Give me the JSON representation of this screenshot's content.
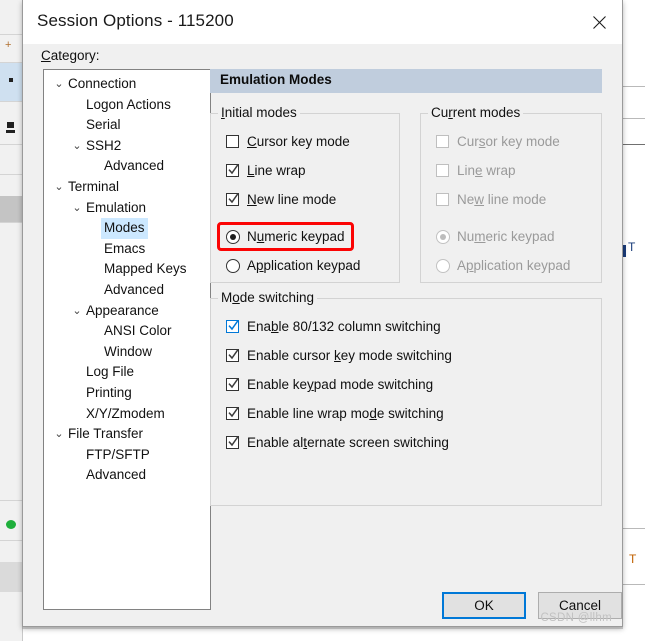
{
  "window": {
    "title": "Session Options - 115200",
    "close_icon": "close-icon"
  },
  "category": {
    "label_prefix": "C",
    "label_rest": "ategory:",
    "tree": [
      {
        "label": "Connection",
        "indent": 0,
        "chevron": "⌄",
        "selected": false
      },
      {
        "label": "Logon Actions",
        "indent": 1,
        "chevron": "",
        "selected": false
      },
      {
        "label": "Serial",
        "indent": 1,
        "chevron": "",
        "selected": false
      },
      {
        "label": "SSH2",
        "indent": 1,
        "chevron": "⌄",
        "selected": false
      },
      {
        "label": "Advanced",
        "indent": 2,
        "chevron": "",
        "selected": false
      },
      {
        "label": "Terminal",
        "indent": 0,
        "chevron": "⌄",
        "selected": false
      },
      {
        "label": "Emulation",
        "indent": 1,
        "chevron": "⌄",
        "selected": false
      },
      {
        "label": "Modes",
        "indent": 2,
        "chevron": "",
        "selected": true
      },
      {
        "label": "Emacs",
        "indent": 2,
        "chevron": "",
        "selected": false
      },
      {
        "label": "Mapped Keys",
        "indent": 2,
        "chevron": "",
        "selected": false
      },
      {
        "label": "Advanced",
        "indent": 2,
        "chevron": "",
        "selected": false
      },
      {
        "label": "Appearance",
        "indent": 1,
        "chevron": "⌄",
        "selected": false
      },
      {
        "label": "ANSI Color",
        "indent": 2,
        "chevron": "",
        "selected": false
      },
      {
        "label": "Window",
        "indent": 2,
        "chevron": "",
        "selected": false
      },
      {
        "label": "Log File",
        "indent": 1,
        "chevron": "",
        "selected": false
      },
      {
        "label": "Printing",
        "indent": 1,
        "chevron": "",
        "selected": false
      },
      {
        "label": "X/Y/Zmodem",
        "indent": 1,
        "chevron": "",
        "selected": false
      },
      {
        "label": "File Transfer",
        "indent": 0,
        "chevron": "⌄",
        "selected": false
      },
      {
        "label": "FTP/SFTP",
        "indent": 1,
        "chevron": "",
        "selected": false
      },
      {
        "label": "Advanced",
        "indent": 1,
        "chevron": "",
        "selected": false
      }
    ]
  },
  "pane": {
    "header": "Emulation Modes"
  },
  "initial_modes": {
    "title_pre": "I",
    "title_post": "nitial modes",
    "checkboxes": [
      {
        "pre": "",
        "acc": "C",
        "post": "ursor key mode",
        "checked": false
      },
      {
        "pre": "",
        "acc": "L",
        "post": "ine wrap",
        "checked": true
      },
      {
        "pre": "",
        "acc": "N",
        "post": "ew line mode",
        "checked": true
      }
    ],
    "radios": [
      {
        "pre": "N",
        "acc": "u",
        "post": "meric keypad",
        "selected": true
      },
      {
        "pre": "A",
        "acc": "p",
        "post": "plication keypad",
        "selected": false
      }
    ]
  },
  "current_modes": {
    "title_pre": "Cu",
    "title_acc": "r",
    "title_post": "rent modes",
    "disabled": true,
    "checkboxes": [
      {
        "pre": "Cur",
        "acc": "s",
        "post": "or key mode",
        "checked": false
      },
      {
        "pre": "Lin",
        "acc": "e",
        "post": " wrap",
        "checked": false
      },
      {
        "pre": "Ne",
        "acc": "w",
        "post": " line mode",
        "checked": false
      }
    ],
    "radios": [
      {
        "pre": "Nu",
        "acc": "m",
        "post": "eric keypad",
        "selected": true
      },
      {
        "pre": "A",
        "acc": "p",
        "post": "plication keypad",
        "selected": false
      }
    ]
  },
  "mode_switching": {
    "title_pre": "M",
    "title_acc": "o",
    "title_post": "de switching",
    "checkboxes": [
      {
        "pre": "Ena",
        "acc": "b",
        "post": "le 80/132 column switching",
        "checked": true,
        "focused": true
      },
      {
        "pre": "Enable cursor ",
        "acc": "k",
        "post": "ey mode switching",
        "checked": true,
        "focused": false
      },
      {
        "pre": "Enable ke",
        "acc": "y",
        "post": "pad mode switching",
        "checked": true,
        "focused": false
      },
      {
        "pre": "Enable line wrap mo",
        "acc": "d",
        "post": "e switching",
        "checked": true,
        "focused": false
      },
      {
        "pre": "Enable al",
        "acc": "t",
        "post": "ernate screen switching",
        "checked": true,
        "focused": false
      }
    ]
  },
  "buttons": {
    "ok": "OK",
    "cancel": "Cancel"
  },
  "watermark": "CSDN @llhm",
  "colors": {
    "dialog_bg": "#f0f0f0",
    "pane_header_bg": "#c0cddd",
    "tree_selection": "#cce8ff",
    "focus_blue": "#0078d7",
    "annotation_red": "#fb0404",
    "disabled_text": "#9a9a9a"
  }
}
